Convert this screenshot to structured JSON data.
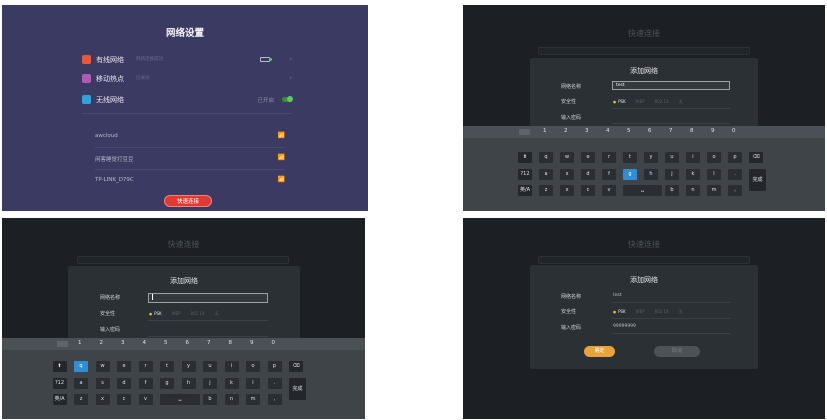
{
  "panel1": {
    "title": "网络设置",
    "wired": {
      "label": "有线网络",
      "status": "网络连接成功"
    },
    "hotspot": {
      "label": "移动热点",
      "status": "已关闭"
    },
    "wireless": {
      "label": "无线网络",
      "state": "已开启"
    },
    "networks": [
      {
        "name": "awcloud"
      },
      {
        "name": "闲客睡觉打豆豆"
      },
      {
        "name": "TP-LINK_D79C"
      }
    ],
    "quick_connect": "快速连接",
    "colors": {
      "bg": "#3b3a62",
      "wired_icon": "#e8583e",
      "hotspot_icon": "#b05ab8",
      "wifi_icon": "#2fa3dd",
      "accent": "#e13a33",
      "toggle": "#5ecb5e"
    }
  },
  "dialog": {
    "bg_title": "快速连接",
    "title": "添加网络",
    "name_label": "网络名称",
    "security_label": "安全性",
    "password_label": "输入密码",
    "security_options": [
      "PSK",
      "WEP",
      "802.1X",
      "无"
    ],
    "confirm": "确定",
    "cancel": "取消"
  },
  "panel2": {
    "name_value": "test"
  },
  "panel3": {
    "name_value": ""
  },
  "panel4": {
    "name_value": "test",
    "password_value": "99999999"
  },
  "keyboard": {
    "numbers": [
      "1",
      "2",
      "3",
      "4",
      "5",
      "6",
      "7",
      "8",
      "9",
      "0"
    ],
    "row1": [
      "q",
      "w",
      "e",
      "r",
      "t",
      "y",
      "u",
      "i",
      "o",
      "p"
    ],
    "row2": [
      "a",
      "s",
      "d",
      "f",
      "g",
      "h",
      "j",
      "k",
      "l",
      "."
    ],
    "row3": [
      "z",
      "x",
      "c",
      "v",
      "b",
      "n",
      "m",
      ","
    ],
    "shift": "⬆",
    "sym": "?12",
    "lang": "英/A",
    "space": "␣",
    "backspace": "⌫",
    "done": "完成",
    "p2_selected": "g",
    "p3_selected": "q"
  }
}
